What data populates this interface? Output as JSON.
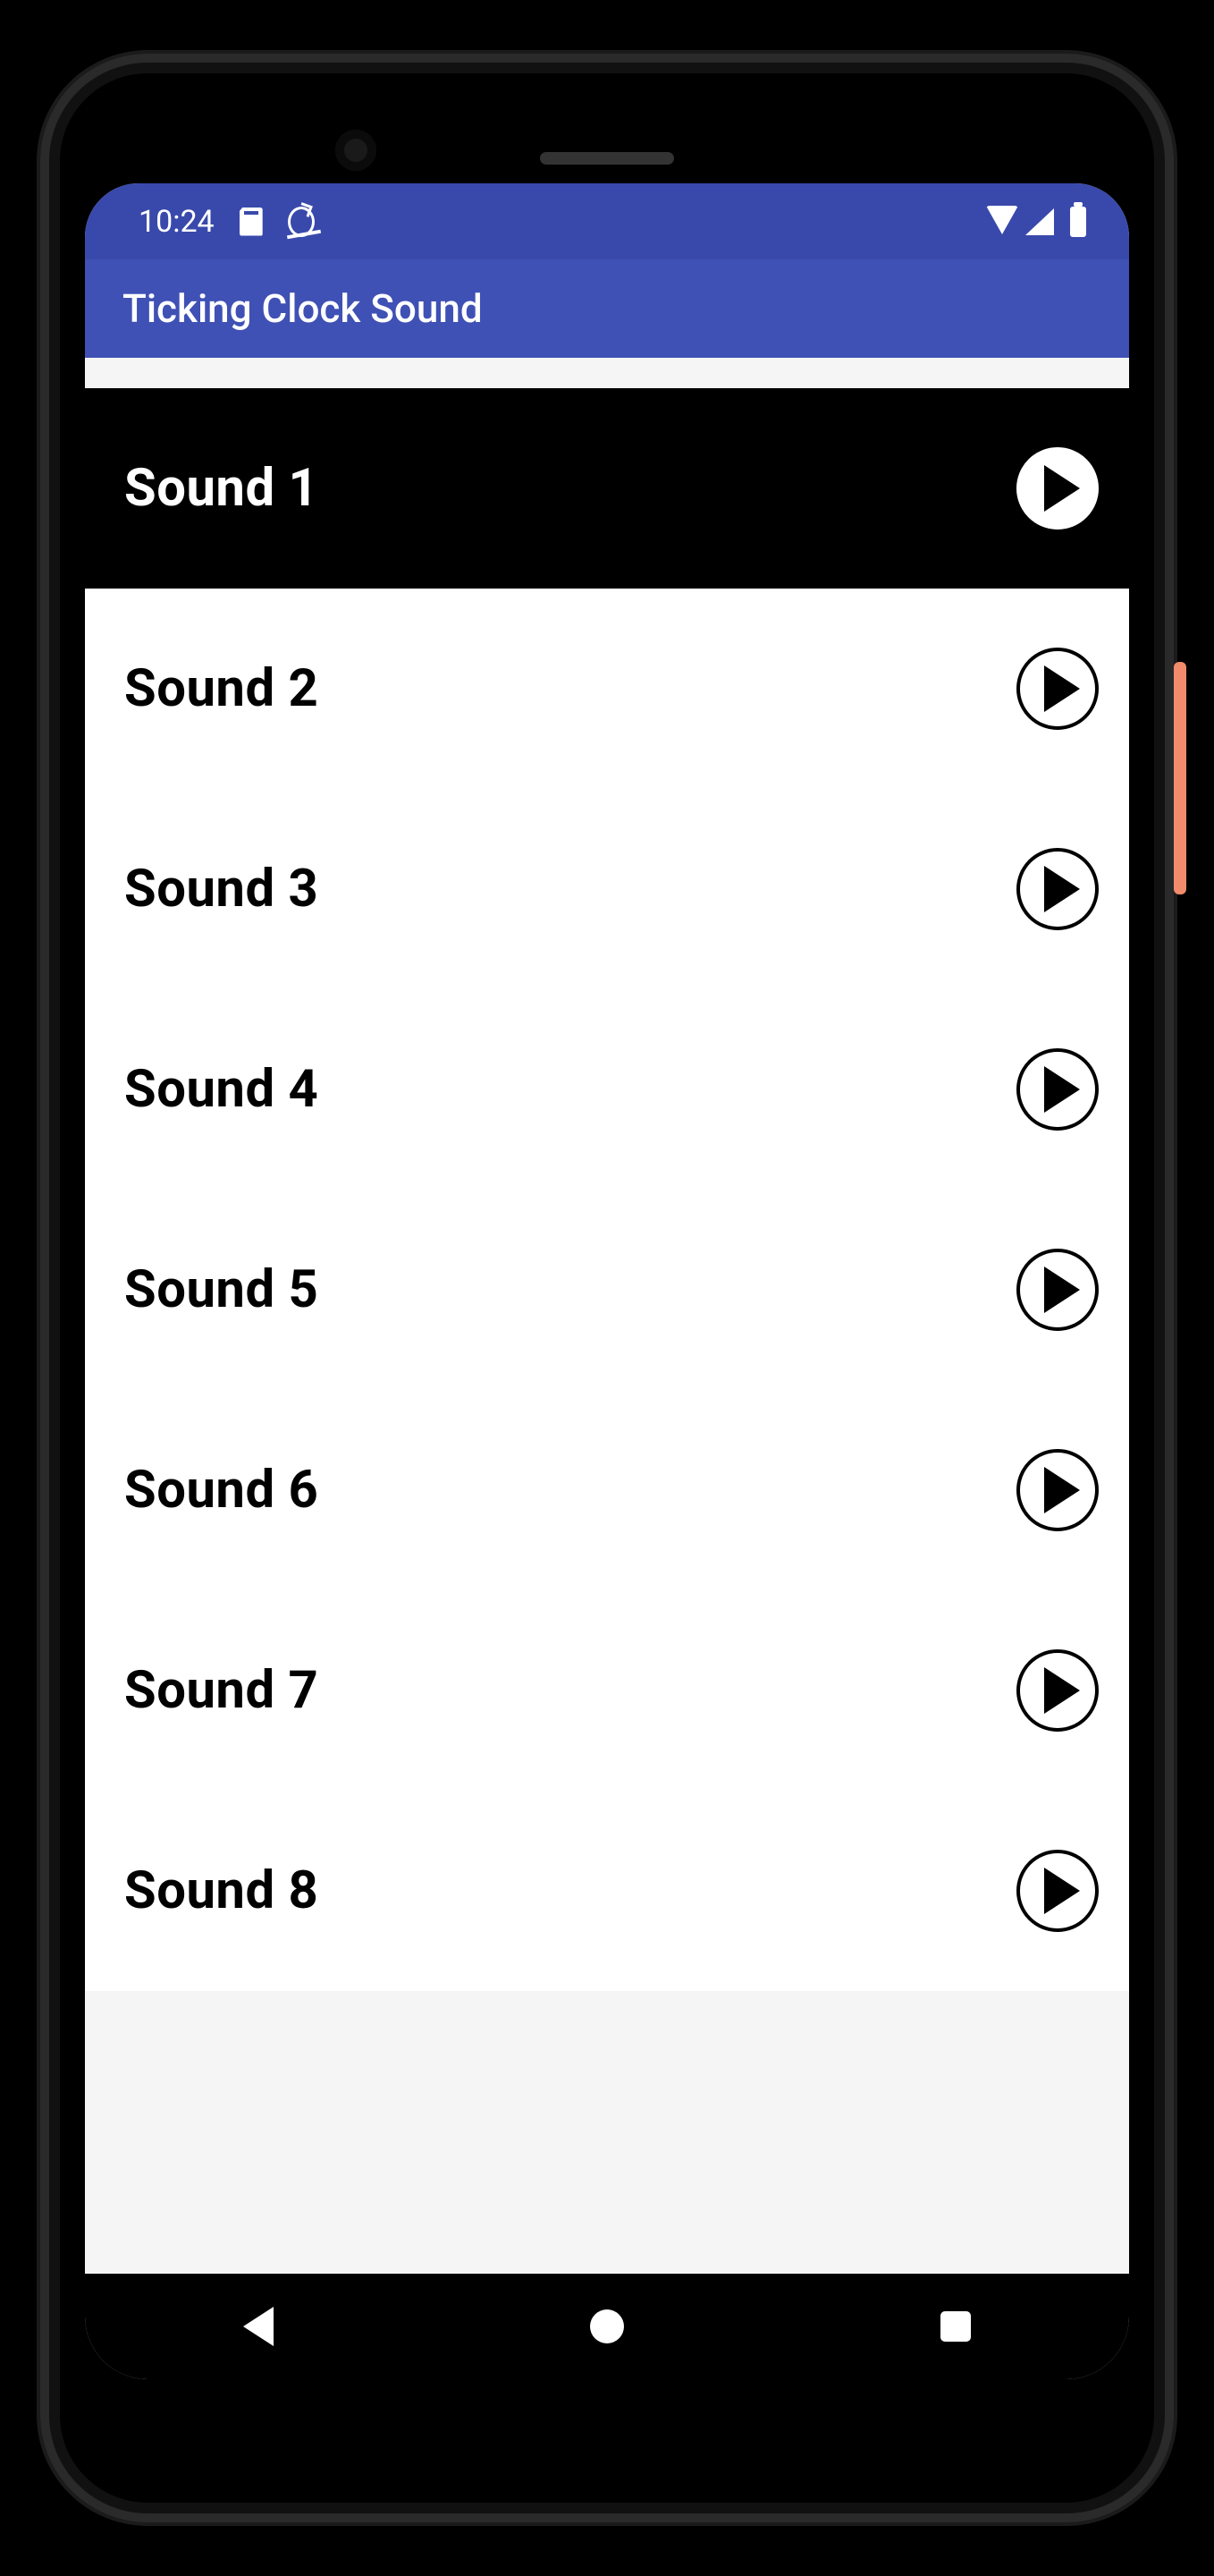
{
  "status": {
    "time": "10:24"
  },
  "app": {
    "title": "Ticking Clock Sound"
  },
  "sounds": [
    {
      "label": "Sound 1",
      "selected": true
    },
    {
      "label": "Sound 2",
      "selected": false
    },
    {
      "label": "Sound 3",
      "selected": false
    },
    {
      "label": "Sound 4",
      "selected": false
    },
    {
      "label": "Sound 5",
      "selected": false
    },
    {
      "label": "Sound 6",
      "selected": false
    },
    {
      "label": "Sound 7",
      "selected": false
    },
    {
      "label": "Sound 8",
      "selected": false
    }
  ],
  "colors": {
    "status_bar": "#3949ab",
    "app_bar": "#3f51b5",
    "selected_row_bg": "#000000",
    "row_bg": "#ffffff"
  }
}
